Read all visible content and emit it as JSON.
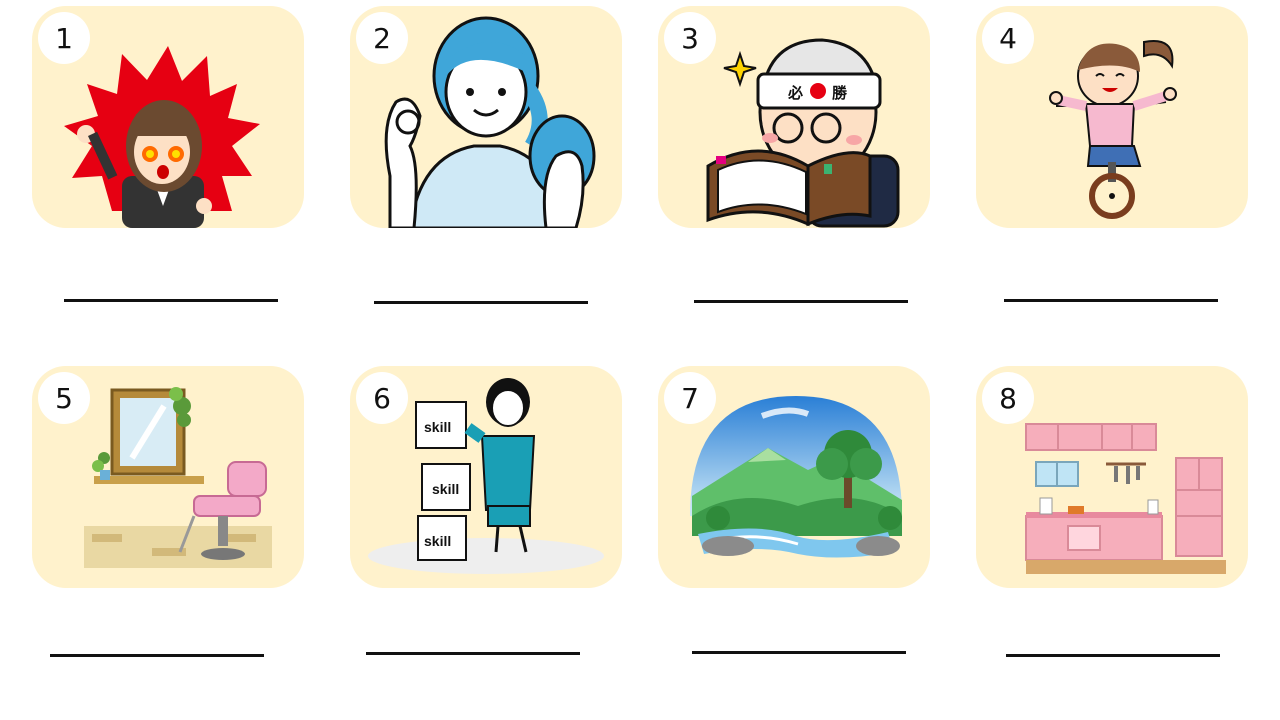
{
  "cards": [
    {
      "number": "1",
      "icon": "angry-businesswoman-icon"
    },
    {
      "number": "2",
      "icon": "woman-okay-sign-with-purse-icon"
    },
    {
      "number": "3",
      "icon": "student-studying-with-headband-icon",
      "headband_text": "必 勝"
    },
    {
      "number": "4",
      "icon": "girl-riding-unicycle-icon"
    },
    {
      "number": "5",
      "icon": "salon-chair-and-mirror-icon"
    },
    {
      "number": "6",
      "icon": "woman-stacking-skill-blocks-icon",
      "block_labels": [
        "skill",
        "skill",
        "skill"
      ]
    },
    {
      "number": "7",
      "icon": "mountain-river-landscape-icon"
    },
    {
      "number": "8",
      "icon": "pink-kitchen-icon"
    }
  ]
}
